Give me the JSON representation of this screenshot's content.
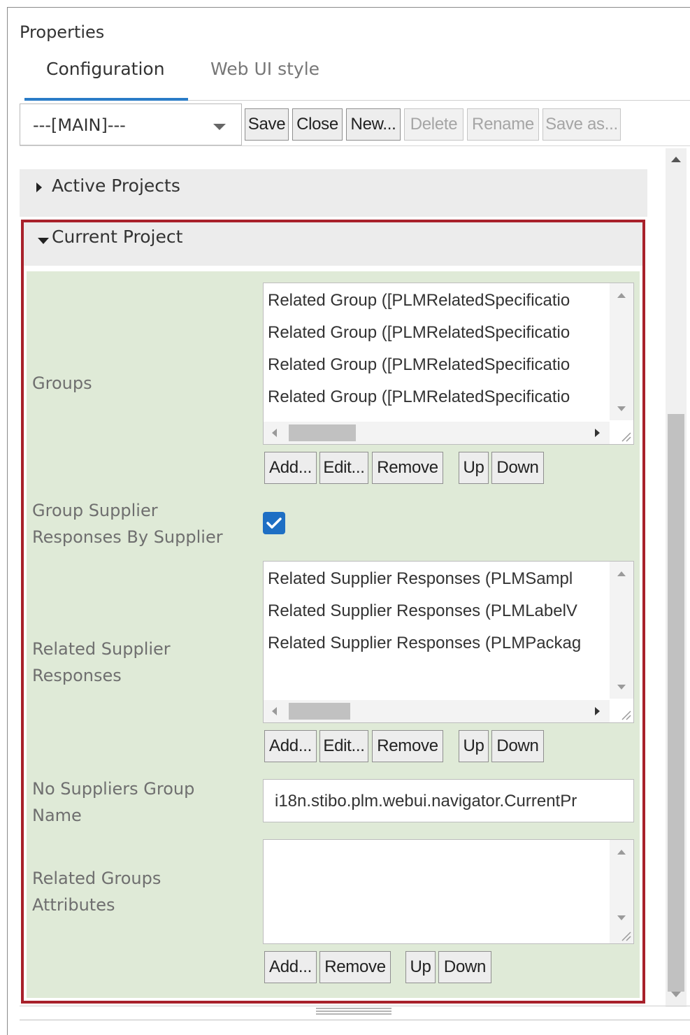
{
  "panel": {
    "title": "Properties"
  },
  "tabs": [
    {
      "label": "Configuration",
      "active": true
    },
    {
      "label": "Web UI style",
      "active": false
    }
  ],
  "toolbar": {
    "config_select_value": "---[MAIN]---",
    "buttons": {
      "save": "Save",
      "close": "Close",
      "new": "New...",
      "delete": "Delete",
      "rename": "Rename",
      "save_as": "Save as..."
    }
  },
  "sections": {
    "active_projects": {
      "label": "Active Projects",
      "expanded": false
    },
    "current_project": {
      "label": "Current Project",
      "expanded": true
    }
  },
  "fields": {
    "groups": {
      "label": "Groups",
      "items": [
        "Related Group ([PLMRelatedSpecificatio",
        "Related Group ([PLMRelatedSpecificatio",
        "Related Group ([PLMRelatedSpecificatio",
        "Related Group ([PLMRelatedSpecificatio"
      ],
      "buttons": {
        "add": "Add...",
        "edit": "Edit...",
        "remove": "Remove",
        "up": "Up",
        "down": "Down"
      }
    },
    "group_by_supplier": {
      "label_line1": "Group Supplier",
      "label_line2": "Responses By Supplier",
      "checked": true
    },
    "related_supplier_responses": {
      "label_line1": "Related Supplier",
      "label_line2": "Responses",
      "items": [
        "Related Supplier Responses (PLMSampl",
        "Related Supplier Responses (PLMLabelV",
        "Related Supplier Responses (PLMPackag"
      ],
      "buttons": {
        "add": "Add...",
        "edit": "Edit...",
        "remove": "Remove",
        "up": "Up",
        "down": "Down"
      }
    },
    "no_suppliers_group_name": {
      "label_line1": "No Suppliers Group",
      "label_line2": "Name",
      "value": "i18n.stibo.plm.webui.navigator.CurrentPr"
    },
    "related_groups_attributes": {
      "label_line1": "Related Groups",
      "label_line2": "Attributes",
      "items": [],
      "buttons": {
        "add": "Add...",
        "remove": "Remove",
        "up": "Up",
        "down": "Down"
      }
    }
  },
  "colors": {
    "accent": "#2a7cc7",
    "highlight_border": "#a8212b",
    "form_background": "#dfead7",
    "checkbox": "#1e6fc4"
  }
}
